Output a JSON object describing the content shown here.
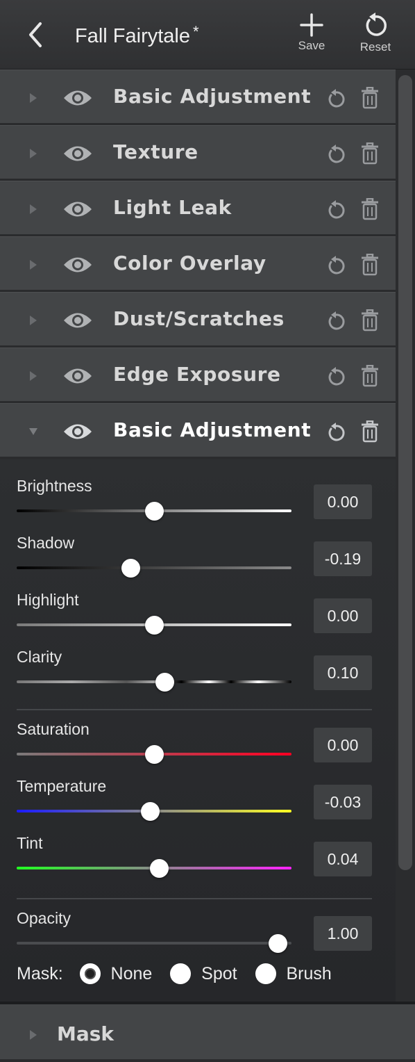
{
  "header": {
    "title": "Fall Fairytale",
    "dirty_marker": "*",
    "save_label": "Save",
    "reset_label": "Reset"
  },
  "layers": [
    {
      "label": "Basic Adjustment",
      "expanded": false
    },
    {
      "label": "Texture",
      "expanded": false
    },
    {
      "label": "Light Leak",
      "expanded": false
    },
    {
      "label": "Color Overlay",
      "expanded": false
    },
    {
      "label": "Dust/Scratches",
      "expanded": false
    },
    {
      "label": "Edge Exposure",
      "expanded": false
    },
    {
      "label": "Basic Adjustment",
      "expanded": true
    }
  ],
  "adjustments": {
    "brightness": {
      "label": "Brightness",
      "value": "0.00",
      "level": 0.5
    },
    "shadow": {
      "label": "Shadow",
      "value": "-0.19",
      "level": 0.415
    },
    "highlight": {
      "label": "Highlight",
      "value": "0.00",
      "level": 0.5
    },
    "clarity": {
      "label": "Clarity",
      "value": "0.10",
      "level": 0.54
    },
    "saturation": {
      "label": "Saturation",
      "value": "0.00",
      "level": 0.5
    },
    "temperature": {
      "label": "Temperature",
      "value": "-0.03",
      "level": 0.485
    },
    "tint": {
      "label": "Tint",
      "value": "0.04",
      "level": 0.52
    },
    "opacity": {
      "label": "Opacity",
      "value": "1.00",
      "level": 0.95
    }
  },
  "mask_options": {
    "label": "Mask:",
    "options": [
      "None",
      "Spot",
      "Brush"
    ],
    "selected": "None"
  },
  "mask_section": {
    "label": "Mask"
  },
  "colors": {
    "header_bg": "#36373a",
    "row_bg": "#434547",
    "panel_bg": "#2a2c2e",
    "valbox_bg": "#3f4143",
    "knob": "#ffffff"
  }
}
